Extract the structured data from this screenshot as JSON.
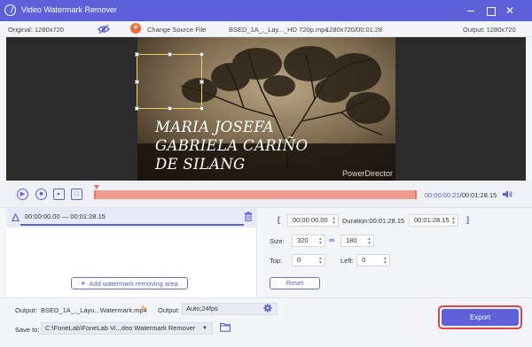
{
  "window": {
    "title": "Video Watermark Remover",
    "minimize": "—",
    "maximize": "",
    "close": "✕"
  },
  "infobar": {
    "original": "Original: 1280x720",
    "change_source": "Change Source File",
    "filename": "BSED_1A_,_Lay..._HD 720p.mp4",
    "file_info": "1280x720/00:01:28",
    "output": "Output: 1280x720"
  },
  "video": {
    "overlay_lines": [
      "MARIA JOSEFA",
      "GABRIELA CARIÑO",
      "DE SILANG"
    ],
    "watermark_text": "PowerDirector"
  },
  "controls": {
    "current_time": "00:00:00.21",
    "total_time": "/00:01:28.15"
  },
  "segment": {
    "range": "00:00:00.00 — 00:01:28.15"
  },
  "add_area_label": "Add watermark removing area",
  "settings": {
    "start": "00:00:00.00",
    "duration_label": "Duration:00:01:28.15",
    "end": "00:01:28.15",
    "size_label": "Size:",
    "width": "320",
    "height": "180",
    "top_label": "Top:",
    "top": "0",
    "left_label": "Left:",
    "left": "0",
    "reset_label": "Reset"
  },
  "bottom": {
    "output_label": "Output:",
    "output_file": "BSED_1A_,_Layu...Watermark.mp4",
    "output_format_label": "Output:",
    "output_format": "Auto;24fps",
    "save_to_label": "Save to:",
    "save_path": "C:\\FoneLab\\FoneLab Vi...deo Watermark Remover",
    "export_label": "Export"
  },
  "colors": {
    "accent": "#5d60d8",
    "timeline": "#ef9b8f",
    "highlight": "#e0454c",
    "add_icon": "#f06a3c"
  },
  "icons": [
    "app-logo-icon",
    "eye-icon",
    "add-icon",
    "play-icon",
    "stop-icon",
    "next-frame-icon",
    "fullscreen-icon",
    "volume-icon",
    "segment-icon",
    "trash-icon",
    "link-icon",
    "pencil-icon",
    "gear-icon",
    "folder-icon"
  ]
}
